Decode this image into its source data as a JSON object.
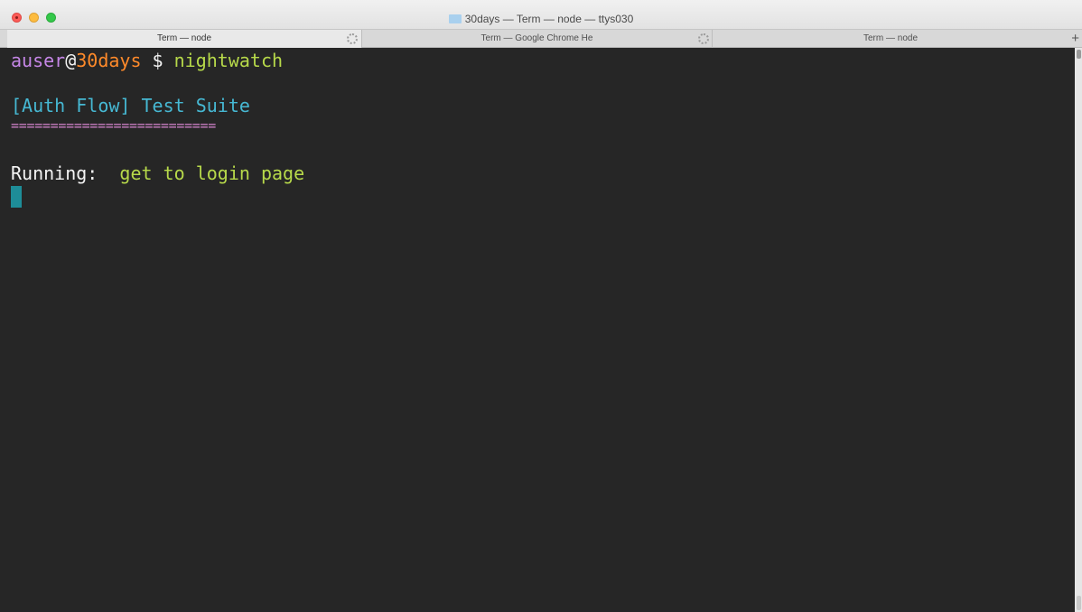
{
  "window": {
    "title": "30days — Term — node — ttys030"
  },
  "tabs": [
    {
      "label": "Term — node"
    },
    {
      "label": "Term — Google Chrome He"
    },
    {
      "label": "Term — node"
    }
  ],
  "new_tab_label": "+",
  "terminal": {
    "prompt": {
      "user": "auser",
      "at": "@",
      "host": "30days",
      "symbol": " $ ",
      "command": "nightwatch"
    },
    "suite_title": "[Auth Flow] Test Suite",
    "suite_separator": "==========================",
    "running_label": "Running:",
    "running_test": "get to login page"
  },
  "colors": {
    "terminal_bg": "#262626",
    "user": "#c586e6",
    "host": "#ff8a2a",
    "command": "#b7d94a",
    "suite": "#46b8d3",
    "separator": "#d786d0",
    "cursor": "#1e8d98"
  },
  "icons": {
    "close": "close-icon",
    "minimize": "minimize-icon",
    "maximize": "maximize-icon",
    "folder": "folder-icon",
    "spinner": "spinner-icon"
  }
}
